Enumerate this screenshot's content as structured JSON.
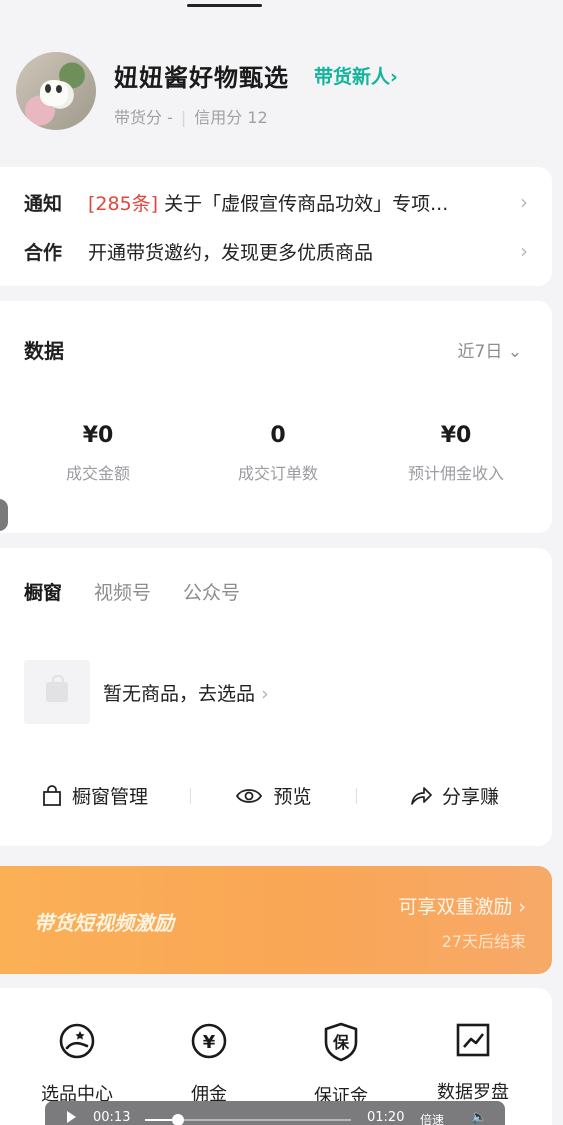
{
  "header": {
    "shop_name": "妞妞酱好物甄选",
    "level_link": "带货新人",
    "goods_score_label": "带货分 -",
    "credit_score_label": "信用分 12"
  },
  "notice": {
    "rows": [
      {
        "tag": "通知",
        "highlight": "[285条]",
        "text": " 关于「虚假宣传商品功效」专项..."
      },
      {
        "tag": "合作",
        "highlight": "",
        "text": "开通带货邀约，发现更多优质商品"
      }
    ]
  },
  "data_section": {
    "title": "数据",
    "period": "近7日",
    "stats": [
      {
        "value": "¥0",
        "label": "成交金额"
      },
      {
        "value": "0",
        "label": "成交订单数"
      },
      {
        "value": "¥0",
        "label": "预计佣金收入"
      }
    ]
  },
  "window_section": {
    "tabs": [
      "橱窗",
      "视频号",
      "公众号"
    ],
    "empty_text": "暂无商品，去选品",
    "actions": [
      "橱窗管理",
      "预览",
      "分享赚"
    ]
  },
  "banner": {
    "title": "带货短视频激励",
    "right_text": "可享双重激励",
    "sub_text": "27天后结束"
  },
  "tools": [
    {
      "label": "选品中心",
      "icon": "product-select-icon"
    },
    {
      "label": "佣金",
      "icon": "yen-icon"
    },
    {
      "label": "保证金",
      "icon": "deposit-shield-icon"
    },
    {
      "label": "数据罗盘",
      "icon": "chart-icon"
    }
  ],
  "player": {
    "current_time": "00:13",
    "duration": "01:20",
    "speed_label": "倍速",
    "progress": 0.16
  },
  "colors": {
    "accent": "#14b39b",
    "highlight": "#e3463d",
    "banner": "#fbb056"
  }
}
